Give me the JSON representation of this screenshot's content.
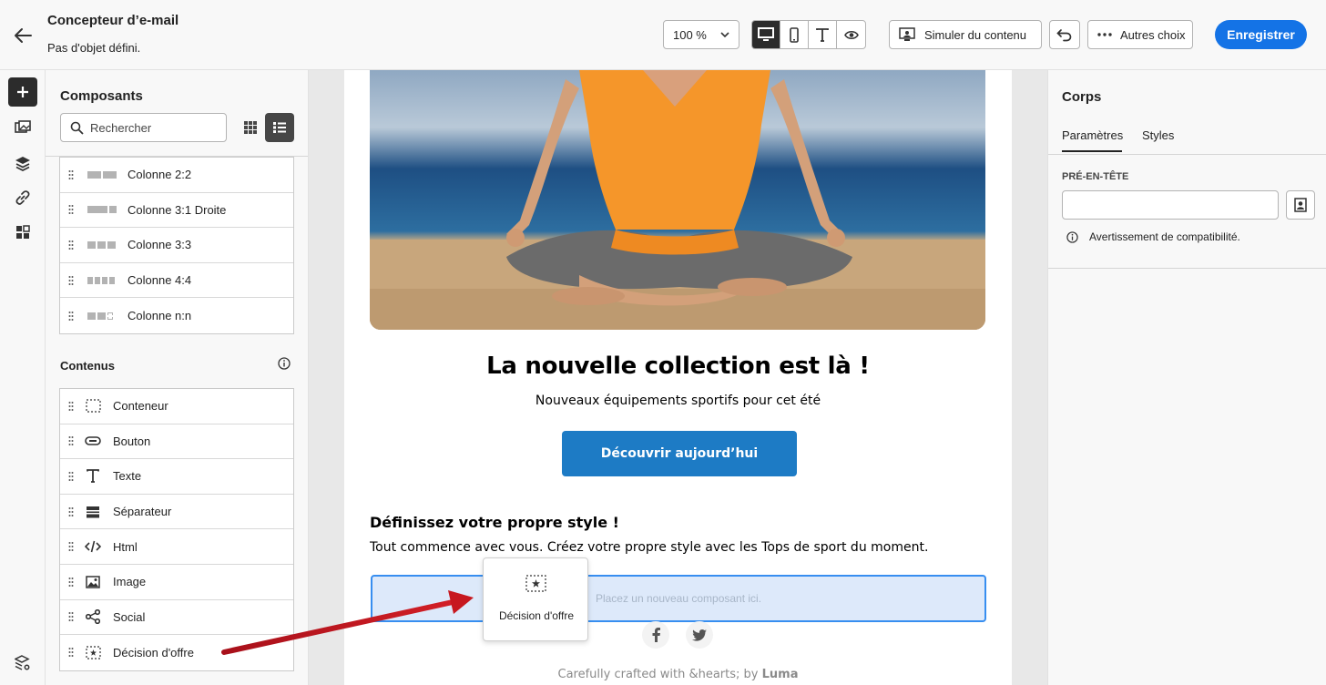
{
  "header": {
    "title": "Concepteur d’e-mail",
    "subtitle": "Pas d'objet défini.",
    "zoom": "100 %",
    "simulate_label": "Simuler du contenu",
    "more_label": "Autres choix",
    "save_label": "Enregistrer"
  },
  "components": {
    "title": "Composants",
    "search_placeholder": "Rechercher",
    "structures": [
      {
        "label": "Colonne 2:2"
      },
      {
        "label": "Colonne 3:1 Droite"
      },
      {
        "label": "Colonne 3:3"
      },
      {
        "label": "Colonne 4:4"
      },
      {
        "label": "Colonne n:n"
      }
    ],
    "contents_title": "Contenus",
    "contents": [
      {
        "label": "Conteneur",
        "icon": "container-icon"
      },
      {
        "label": "Bouton",
        "icon": "button-icon"
      },
      {
        "label": "Texte",
        "icon": "text-icon"
      },
      {
        "label": "Séparateur",
        "icon": "divider-icon"
      },
      {
        "label": "Html",
        "icon": "code-icon"
      },
      {
        "label": "Image",
        "icon": "image-icon"
      },
      {
        "label": "Social",
        "icon": "share-icon"
      },
      {
        "label": "Décision d'offre",
        "icon": "offer-decision-icon"
      }
    ]
  },
  "email": {
    "headline": "La nouvelle collection est là !",
    "subline": "Nouveaux équipements sportifs pour cet été",
    "cta": "Découvrir aujourd’hui",
    "section_title": "Définissez votre propre style !",
    "section_text": "Tout commence avec vous. Créez votre propre style avec les Tops de sport du moment.",
    "drop_placeholder": "Placez un nouveau composant ici.",
    "footer_prefix": "Carefully crafted with &hearts; by ",
    "footer_brand": "Luma"
  },
  "drag_ghost": {
    "label": "Décision d'offre"
  },
  "properties": {
    "title": "Corps",
    "tabs": [
      "Paramètres",
      "Styles"
    ],
    "field_label": "PRÉ-EN-TÊTE",
    "warning": "Avertissement de compatibilité."
  },
  "colors": {
    "accent": "#1473e6",
    "cta": "#1d7bc5",
    "annotation_arrow": "#c0161c"
  }
}
